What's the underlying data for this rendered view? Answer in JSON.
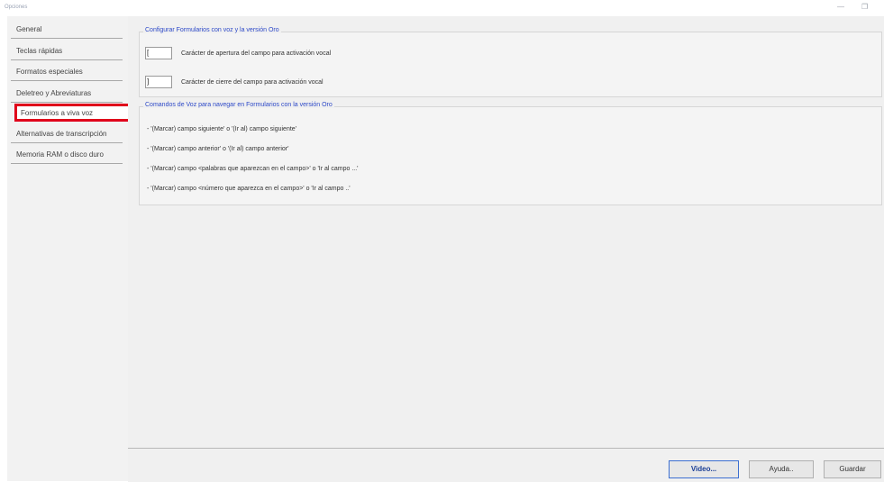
{
  "window": {
    "title": "Opciones",
    "minimize_symbol": "—",
    "restore_symbol": "❐"
  },
  "sidebar": {
    "items": [
      {
        "label": "General"
      },
      {
        "label": "Teclas rápidas"
      },
      {
        "label": "Formatos especiales"
      },
      {
        "label": "Deletreo y Abreviaturas"
      },
      {
        "label": "Formularios a viva voz"
      },
      {
        "label": "Alternativas de transcripción"
      },
      {
        "label": "Memoria RAM o disco duro"
      }
    ],
    "selected_index": 4,
    "highlight_color": "#e0001b"
  },
  "config_group": {
    "title": "Configurar Formularios con voz y la versión Oro",
    "open_char": {
      "value": "[",
      "label": "Carácter de apertura del campo para activación vocal"
    },
    "close_char": {
      "value": "]",
      "label": "Carácter de cierre del campo para activación vocal"
    }
  },
  "commands_group": {
    "title": "Comandos de Voz para navegar en Formularios con la versión Oro",
    "lines": [
      "- '(Marcar) campo siguiente' o '(Ir al) campo siguiente'",
      "- '(Marcar) campo anterior' o '(Ir al) campo anterior'",
      "- '(Marcar) campo <palabras que aparezcan en el campo>' o 'Ir al campo ...'",
      "- '(Marcar) campo <número que aparezca en el campo>' o 'Ir al campo ..'"
    ]
  },
  "footer": {
    "video_label": "Video...",
    "help_label": "Ayuda..",
    "save_label": "Guardar"
  },
  "colors": {
    "group_title": "#2d49c8",
    "accent_button": "#3c6fd1"
  }
}
